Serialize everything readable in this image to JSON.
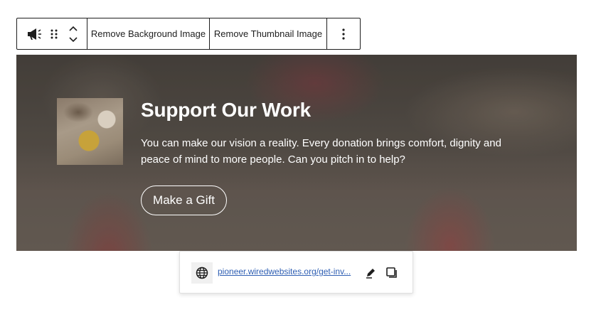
{
  "toolbar": {
    "remove_background_label": "Remove Background Image",
    "remove_thumbnail_label": "Remove Thumbnail Image",
    "icons": [
      "megaphone-icon",
      "drag-handle-icon",
      "move-up-icon",
      "move-down-icon",
      "more-options-icon"
    ]
  },
  "cover": {
    "title": "Support Our Work",
    "body": " You can make our vision a reality. Every donation brings comfort, dignity and peace of mind to more people. Can you pitch in to help?",
    "button_label": "Make a Gift"
  },
  "link_popover": {
    "url_display": "pioneer.wiredwebsites.org/get-inv...",
    "icons": [
      "globe-icon",
      "edit-pencil-icon",
      "copy-icon"
    ]
  },
  "colors": {
    "link": "#2f5fb3",
    "toolbar_border": "#1e1e1e",
    "text_on_cover": "#ffffff"
  }
}
